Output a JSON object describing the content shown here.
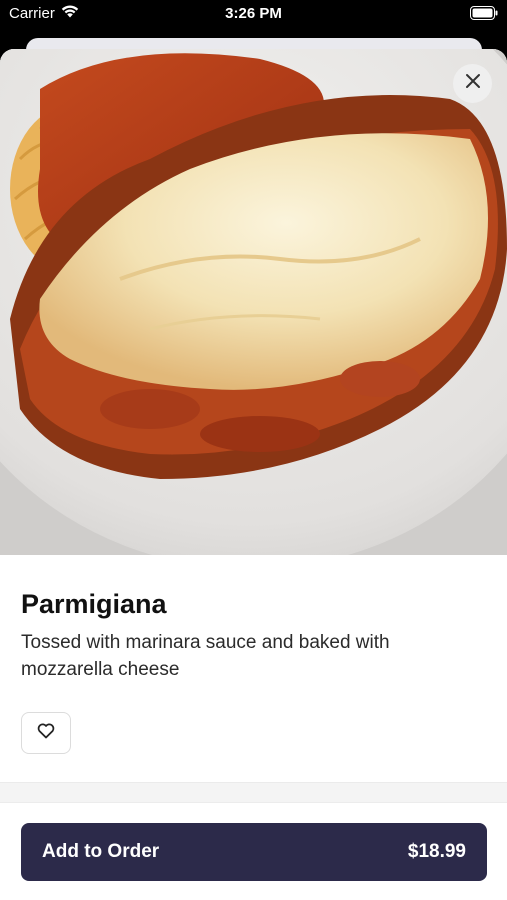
{
  "status_bar": {
    "carrier": "Carrier",
    "time": "3:26 PM",
    "icons": [
      "wifi-icon",
      "battery-icon"
    ]
  },
  "item": {
    "image": "Parmigiana photo",
    "title": "Parmigiana",
    "description": "Tossed with marinara sauce and baked with mozzarella cheese"
  },
  "actions": {
    "close_icon": "close-icon",
    "favorite_icon": "heart-icon",
    "add_label": "Add to Order",
    "price": "$18.99"
  },
  "colors": {
    "primary_button": "#2c2a4a",
    "background": "#ffffff"
  }
}
